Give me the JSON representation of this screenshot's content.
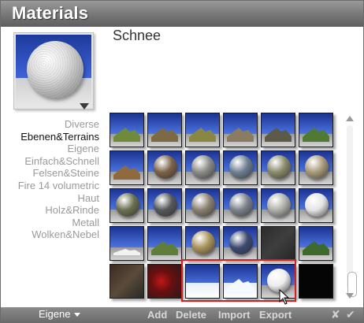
{
  "window": {
    "title": "Materials"
  },
  "material": {
    "name": "Schnee"
  },
  "categories": [
    {
      "label": "Diverse",
      "active": false
    },
    {
      "label": "Ebenen&Terrains",
      "active": true
    },
    {
      "label": "Eigene",
      "active": false
    },
    {
      "label": "Einfach&Schnell",
      "active": false
    },
    {
      "label": "Felsen&Steine",
      "active": false
    },
    {
      "label": "Fire 14 volumetric",
      "active": false
    },
    {
      "label": "Haut",
      "active": false
    },
    {
      "label": "Holz&Rinde",
      "active": false
    },
    {
      "label": "Metall",
      "active": false
    },
    {
      "label": "Wolken&Nebel",
      "active": false
    }
  ],
  "thumbnails": [
    [
      "terrain-green",
      "terrain-brown",
      "terrain-olive",
      "terrain-rocky",
      "terrain-dark",
      "terrain-green-hill"
    ],
    [
      "terrain-rust",
      "rock-sphere-brown",
      "rock-sphere-grey",
      "rock-sphere-blue",
      "rock-sphere-olive",
      "rock-sphere-sand"
    ],
    [
      "rock-sphere-mossy",
      "rock-sphere-dark",
      "rock-sphere-granite",
      "rock-sphere-slate",
      "rock-sphere-pale",
      "rock-sphere-white"
    ],
    [
      "terrain-snow-flat",
      "terrain-grass-hill",
      "rock-sphere-gold",
      "rock-sphere-navy",
      "texture-dark-rock",
      "terrain-forest-peak"
    ],
    [
      "texture-lava-dark",
      "texture-lava-red",
      "snow-plane",
      "snow-peaks",
      "snow-sphere",
      "texture-black"
    ]
  ],
  "selection": {
    "label": "Schnee"
  },
  "footer": {
    "dropdown_label": "Eigene",
    "add": "Add",
    "delete": "Delete",
    "import": "Import",
    "export": "Export",
    "cancel_icon": "close-icon",
    "confirm_icon": "check-icon"
  },
  "colors": {
    "title_bar": "#7c7c7c",
    "selection": "#d42020",
    "active_category": "#111111"
  }
}
